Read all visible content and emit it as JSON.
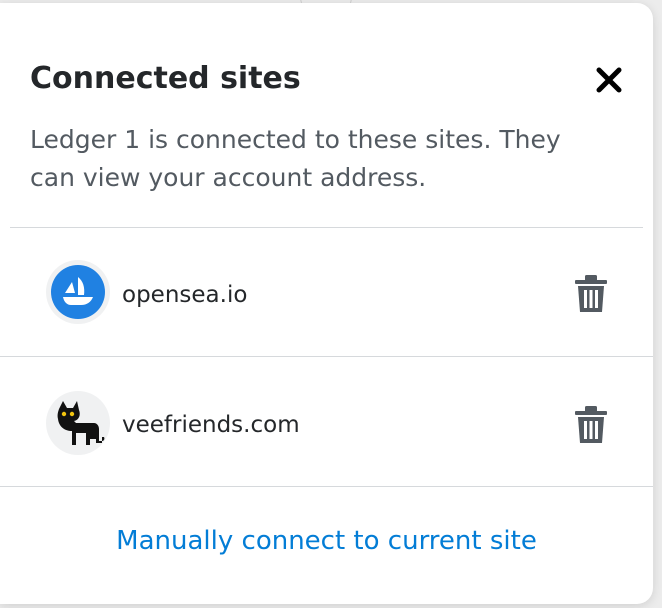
{
  "modal": {
    "title": "Connected sites",
    "description": "Ledger 1 is connected to these sites. They can view your account address.",
    "close_icon": "close-icon"
  },
  "sites": [
    {
      "name": "opensea.io",
      "icon": "opensea-logo",
      "remove_icon": "trash-icon"
    },
    {
      "name": "veefriends.com",
      "icon": "veefriends-logo",
      "remove_icon": "trash-icon"
    }
  ],
  "footer": {
    "manual_connect_label": "Manually connect to current site"
  },
  "colors": {
    "link": "#037dd6",
    "title": "#24272a",
    "body_text": "#535a61",
    "opensea_blue": "#2081e2",
    "divider": "#d6d9dc"
  }
}
